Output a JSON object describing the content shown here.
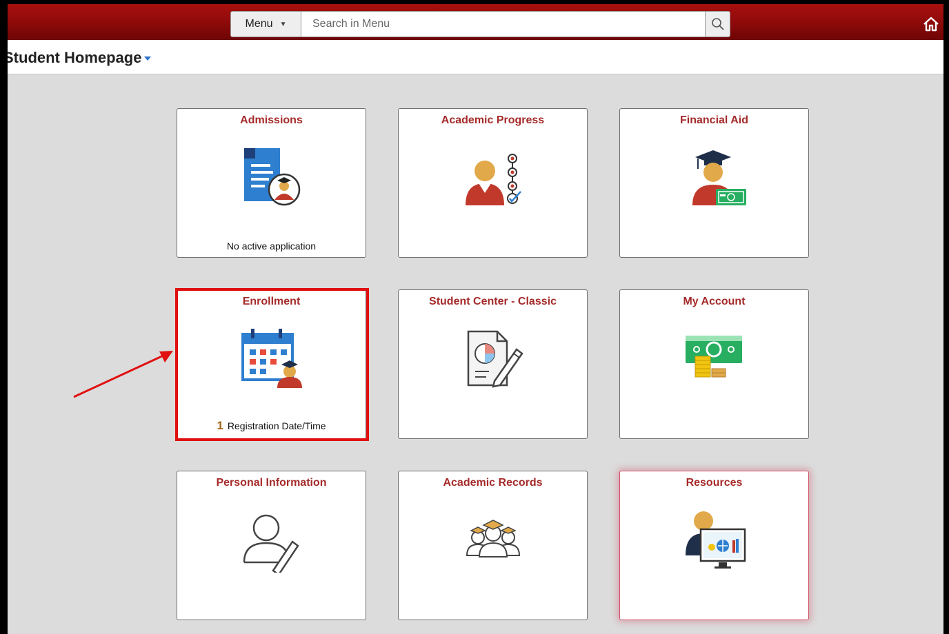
{
  "header": {
    "menu_label": "Menu",
    "search_placeholder": "Search in Menu",
    "search_icon": "search-icon",
    "home_icon": "home-icon"
  },
  "page": {
    "title": "Student Homepage"
  },
  "tiles": [
    {
      "title": "Admissions",
      "footer": "No active application",
      "icon": "application-document-icon"
    },
    {
      "title": "Academic Progress",
      "footer": "",
      "icon": "academic-progress-icon"
    },
    {
      "title": "Financial Aid",
      "footer": "",
      "icon": "financial-aid-icon"
    },
    {
      "title": "Enrollment",
      "footer_count": "1",
      "footer": "Registration Date/Time",
      "icon": "calendar-student-icon"
    },
    {
      "title": "Student Center - Classic",
      "footer": "",
      "icon": "document-pencil-icon"
    },
    {
      "title": "My Account",
      "footer": "",
      "icon": "money-coins-icon"
    },
    {
      "title": "Personal Information",
      "footer": "",
      "icon": "person-edit-icon"
    },
    {
      "title": "Academic Records",
      "footer": "",
      "icon": "graduates-group-icon"
    },
    {
      "title": "Resources",
      "footer": "",
      "icon": "person-monitor-icon"
    }
  ],
  "colors": {
    "header_red": "#8c0a0a",
    "tile_title": "#a52a2a",
    "highlight": "#e01010"
  }
}
